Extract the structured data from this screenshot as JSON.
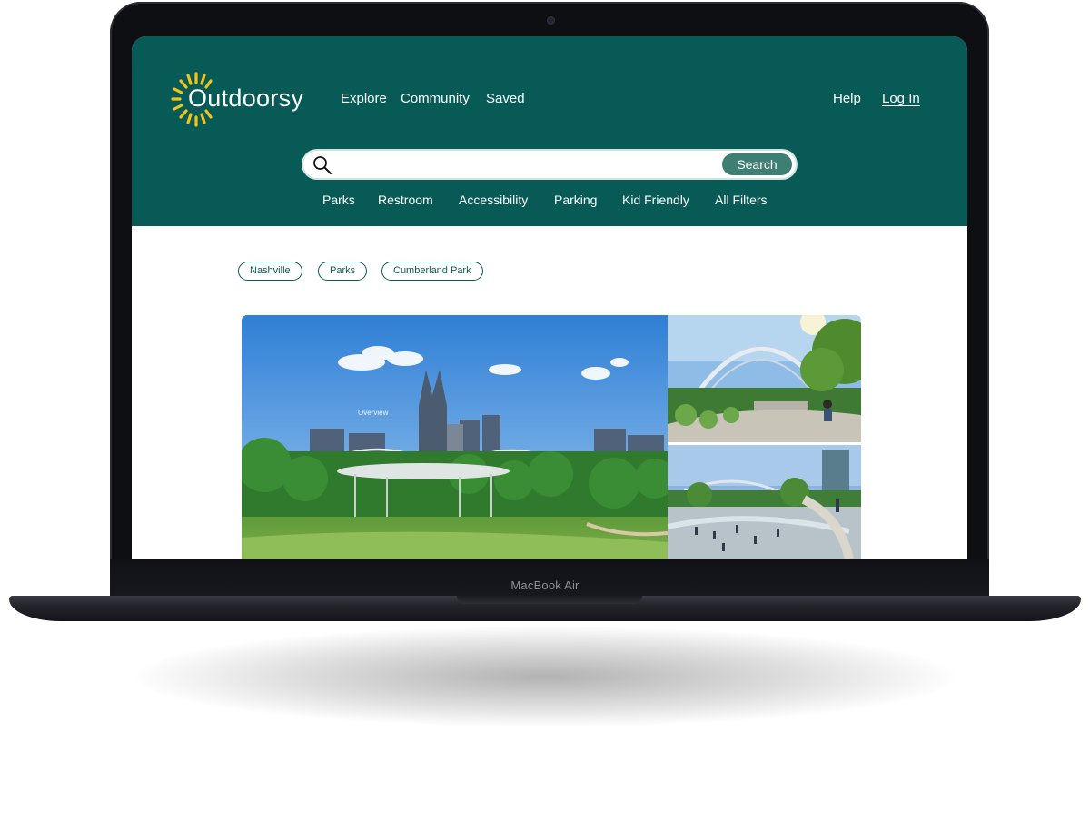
{
  "header": {
    "logo_text": "Outdoorsy",
    "nav": {
      "explore": "Explore",
      "community": "Community",
      "saved": "Saved",
      "help": "Help",
      "login": "Log In"
    }
  },
  "search": {
    "placeholder": "",
    "button_label": "Search"
  },
  "filters": [
    "Parks",
    "Restroom",
    "Accessibility",
    "Parking",
    "Kid Friendly",
    "All Filters"
  ],
  "breadcrumbs": [
    "Nashville",
    "Parks",
    "Cumberland Park"
  ],
  "gallery": {
    "overview_label": "Overview"
  },
  "device": {
    "model_label": "MacBook Air"
  },
  "colors": {
    "header_bg": "#075a55",
    "button_bg": "#3e7f74",
    "logo_sun": "#f2c41a",
    "chip_border": "#075a55"
  },
  "icons": {
    "logo": "sun-icon",
    "search": "search-icon"
  }
}
